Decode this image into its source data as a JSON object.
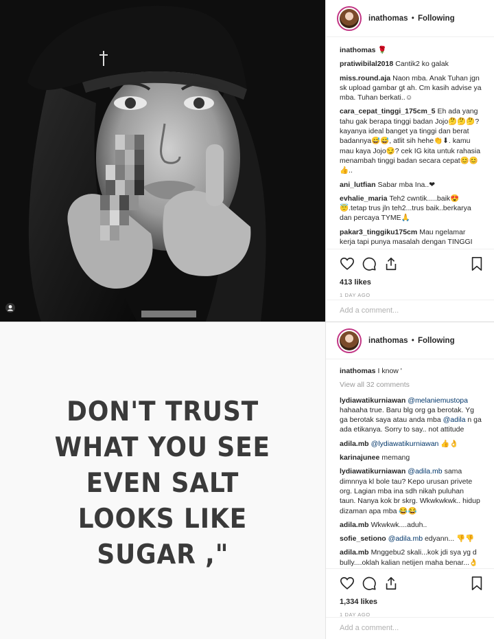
{
  "posts": [
    {
      "header": {
        "username": "inathomas",
        "separator": "•",
        "follow_status": "Following"
      },
      "caption": {
        "username": "inathomas",
        "text": "🌹"
      },
      "comments": [
        {
          "username": "pratiwibilal2018",
          "text": "Cantik2 ko galak"
        },
        {
          "username": "miss.round.aja",
          "text": "Naon mba. Anak Tuhan jgn sk upload gambar gt ah. Cm kasih advise ya mba. Tuhan berkati..☺"
        },
        {
          "username": "cara_cepat_tinggi_175cm_5",
          "text": "Eh ada yang tahu gak berapa tinggi badan Jojo🤔🤔🤔? kayanya ideal banget ya tinggi dan berat badannya😅😅, atlit sih hehe👏⬇. kamu mau kaya Jojo😏? cek IG kita untuk rahasia menambah tinggi badan secara cepat😊😊👍.."
        },
        {
          "username": "ani_lutfian",
          "text": "Sabar mba Ina..❤"
        },
        {
          "username": "evhalie_maria",
          "text": "Teh2 cwntik.....baik😍😇.tetap trus jln teh2...trus baik..berkarya dan percaya TYME🙏"
        },
        {
          "username": "pakar3_tinggiku175cm",
          "text": "Mau ngelamar kerja tapi punya masalah dengan TINGGI"
        }
      ],
      "likes": "413 likes",
      "time": "1 DAY AGO",
      "add_comment_placeholder": "Add a comment..."
    },
    {
      "header": {
        "username": "inathomas",
        "separator": "•",
        "follow_status": "Following"
      },
      "caption": {
        "username": "inathomas",
        "text": "I know '"
      },
      "view_all": "View all 32 comments",
      "comments": [
        {
          "username": "lydiawatikurniawan",
          "mention": "@melaniemustopa",
          "text": "hahaaha true. Baru blg org ga berotak. Yg ga berotak saya atau anda mba",
          "mention2": "@adila",
          "text2": "n ga ada etikanya. Sorry to say.. not attitude"
        },
        {
          "username": "adila.mb",
          "mention": "@lydiawatikurniawan",
          "text": "👍👌"
        },
        {
          "username": "karinajunee",
          "text": "memang"
        },
        {
          "username": "lydiawatikurniawan",
          "mention": "@adila.mb",
          "text": "sama dimnnya kl bole tau? Kepo urusan privete org. Lagian mba ina sdh nikah puluhan taun. Nanya kok br skrg. Wkwkwkwk.. hidup dizaman apa mba 😂😂"
        },
        {
          "username": "adila.mb",
          "text": "Wkwkwk....aduh.."
        },
        {
          "username": "sofie_setiono",
          "mention": "@adila.mb",
          "text": "edyann... 👎👎"
        },
        {
          "username": "adila.mb",
          "text": "Mnggebu2 skali...kok jdi sya yg d bully....oklah kalian netijen maha benar...👌"
        }
      ],
      "quote_lines": [
        "DON'T TRUST",
        "WHAT YOU SEE",
        "EVEN SALT",
        "LOOKS LIKE",
        "SUGAR ,\""
      ],
      "likes": "1,334 likes",
      "time": "1 DAY AGO",
      "add_comment_placeholder": "Add a comment..."
    }
  ],
  "icons": [
    "heart-icon",
    "comment-icon",
    "share-icon",
    "bookmark-icon",
    "user-tag-icon"
  ],
  "colors": {
    "mention": "#003569",
    "muted": "#999999",
    "avatar_ring": "#c13584"
  }
}
